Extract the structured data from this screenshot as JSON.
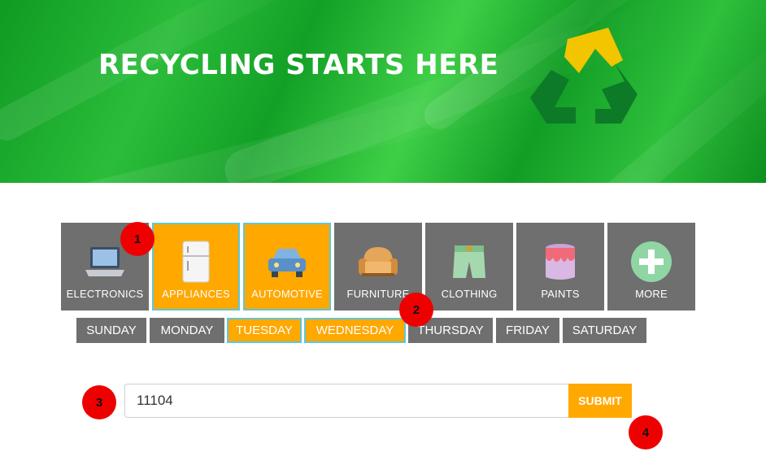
{
  "hero": {
    "title": "RECYCLING STARTS HERE"
  },
  "categories": [
    {
      "label": "ELECTRONICS",
      "icon": "laptop-icon",
      "selected": false
    },
    {
      "label": "APPLIANCES",
      "icon": "refrigerator-icon",
      "selected": true
    },
    {
      "label": "AUTOMOTIVE",
      "icon": "car-icon",
      "selected": true
    },
    {
      "label": "FURNITURE",
      "icon": "sofa-icon",
      "selected": false
    },
    {
      "label": "CLOTHING",
      "icon": "shorts-icon",
      "selected": false
    },
    {
      "label": "PAINTS",
      "icon": "paint-bucket-icon",
      "selected": false
    },
    {
      "label": "MORE",
      "icon": "plus-circle-icon",
      "selected": false
    }
  ],
  "days": [
    {
      "label": "SUNDAY",
      "selected": false
    },
    {
      "label": "MONDAY",
      "selected": false
    },
    {
      "label": "TUESDAY",
      "selected": true
    },
    {
      "label": "WEDNESDAY",
      "selected": true
    },
    {
      "label": "THURSDAY",
      "selected": false
    },
    {
      "label": "FRIDAY",
      "selected": false
    },
    {
      "label": "SATURDAY",
      "selected": false
    }
  ],
  "search": {
    "value": "11104",
    "submit_label": "SUBMIT"
  },
  "annotations": [
    "1",
    "2",
    "3",
    "4"
  ],
  "colors": {
    "accent": "#ffa800",
    "tile": "#6f6f6f",
    "selected_outline": "#5fc6d8",
    "badge": "#ee0000"
  }
}
